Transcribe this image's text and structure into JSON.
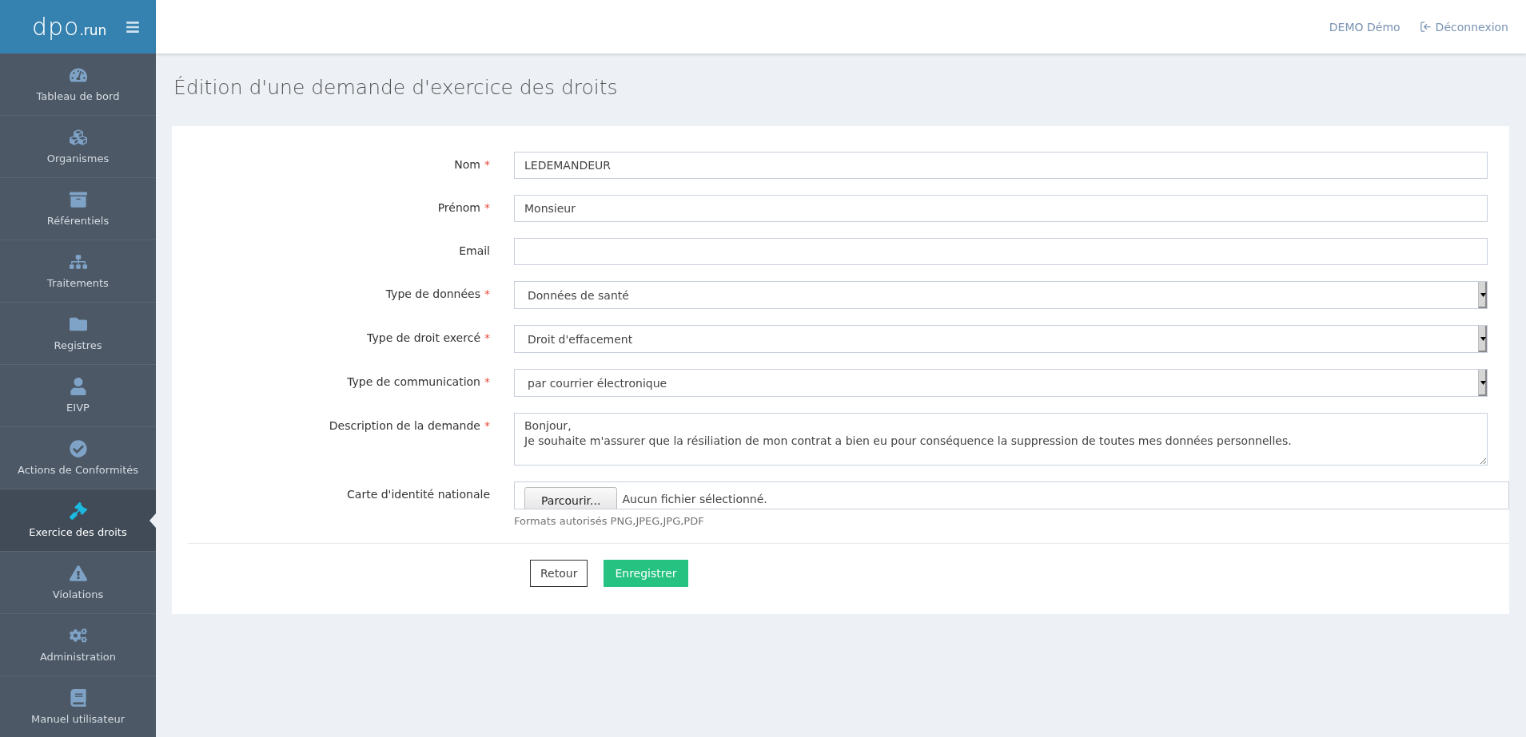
{
  "logo": {
    "main": "dpo",
    "suffix": ".run"
  },
  "header": {
    "user": "DEMO Démo",
    "logout": "Déconnexion"
  },
  "sidebar": {
    "items": [
      {
        "label": "Tableau de bord",
        "selected": false
      },
      {
        "label": "Organismes",
        "selected": false
      },
      {
        "label": "Référentiels",
        "selected": false
      },
      {
        "label": "Traitements",
        "selected": false
      },
      {
        "label": "Registres",
        "selected": false
      },
      {
        "label": "EIVP",
        "selected": false
      },
      {
        "label": "Actions de Conformités",
        "selected": false
      },
      {
        "label": "Exercice des droits",
        "selected": true
      },
      {
        "label": "Violations",
        "selected": false
      },
      {
        "label": "Administration",
        "selected": false
      },
      {
        "label": "Manuel utilisateur",
        "selected": false
      }
    ]
  },
  "page_title": "Édition d'une demande d'exercice des droits",
  "form": {
    "fields": [
      {
        "kind": "text",
        "label": "Nom",
        "required": true,
        "value": "LEDEMANDEUR"
      },
      {
        "kind": "text",
        "label": "Prénom",
        "required": true,
        "value": "Monsieur"
      },
      {
        "kind": "text",
        "label": "Email",
        "required": false
      },
      {
        "kind": "select",
        "label": "Type de données",
        "required": true,
        "value": "Données de santé"
      },
      {
        "kind": "select",
        "label": "Type de droit exercé",
        "required": true,
        "value": "Droit d'effacement"
      },
      {
        "kind": "select",
        "label": "Type de communication",
        "required": true,
        "value": "par courrier électronique"
      },
      {
        "kind": "textarea",
        "label": "Description de la demande",
        "required": true,
        "value": "Bonjour,\nJe souhaite m'assurer que la résiliation de mon contrat a bien eu pour conséquence la suppression de toutes mes données personnelles."
      },
      {
        "kind": "file",
        "label": "Carte d'identité nationale",
        "required": false,
        "button": "Parcourir...",
        "value": "Aucun fichier sélectionné.",
        "help": "Formats autorisés PNG,JPEG,JPG,PDF"
      }
    ],
    "buttons": {
      "back": "Retour",
      "save": "Enregistrer"
    },
    "required_mark": "*"
  }
}
